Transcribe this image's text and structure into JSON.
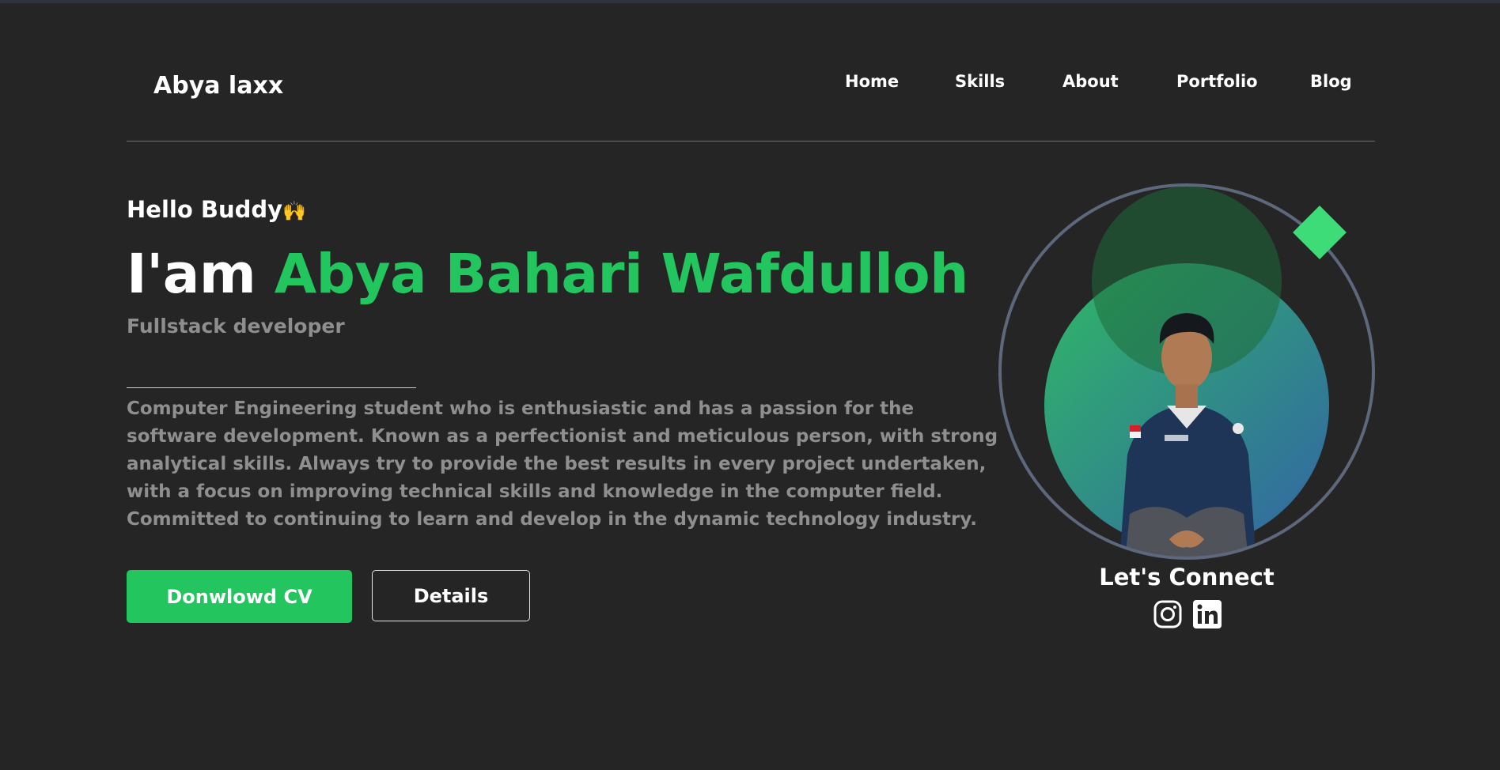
{
  "header": {
    "brand": "Abya laxx",
    "nav": [
      {
        "label": "Home"
      },
      {
        "label": "Skills"
      },
      {
        "label": "About"
      },
      {
        "label": "Portfolio"
      },
      {
        "label": "Blog"
      }
    ]
  },
  "hero": {
    "greeting": "Hello Buddy",
    "greeting_emoji": "🙌",
    "intro": "I'am ",
    "name": "Abya Bahari Wafdulloh",
    "role": "Fullstack developer",
    "bio": "Computer Engineering student who is enthusiastic and has a passion for the software development. Known as a perfectionist and meticulous person, with strong analytical skills. Always try to provide the best results in every project undertaken, with a focus on improving technical skills and knowledge in the computer field. Committed to continuing to learn and develop in the dynamic technology industry.",
    "primary_button": "Donwlowd CV",
    "secondary_button": "Details"
  },
  "profile": {
    "connect_label": "Let's Connect",
    "socials": [
      {
        "icon": "instagram-icon"
      },
      {
        "icon": "linkedin-icon"
      }
    ]
  },
  "colors": {
    "background": "#252525",
    "accent": "#22c55e",
    "muted_text": "#8e8e8e",
    "ring": "#5d687c"
  }
}
